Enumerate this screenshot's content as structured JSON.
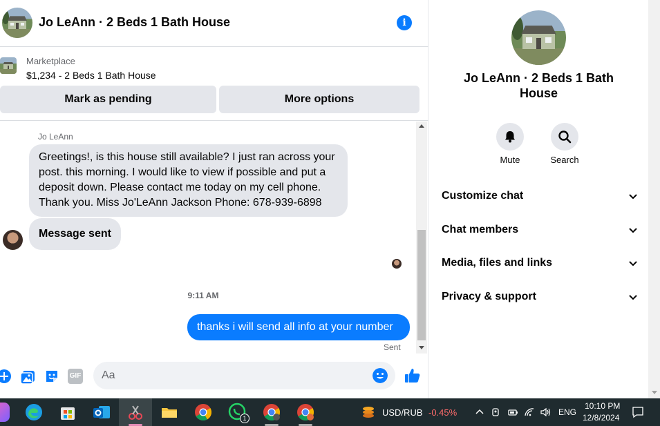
{
  "chat": {
    "title": "Jo LeAnn · 2 Beds 1 Bath House",
    "marketplace": {
      "label": "Marketplace",
      "item": "$1,234 - 2 Beds 1 Bath House",
      "pending_button": "Mark as pending",
      "more_button": "More options"
    },
    "messages": {
      "sender": "Jo LeAnn",
      "incoming_1_lines": [
        "Greetings!, is this house still available? I just ran across your",
        "post. this morning. I would like to view if possible and put a",
        "deposit down. Please contact me today on my cell phone.",
        "Thank you. Miss Jo'LeAnn Jackson Phone: 678-939-6898"
      ],
      "incoming_2": "Message sent",
      "timestamp": "9:11 AM",
      "outgoing_1": "thanks i will send all info at your number",
      "status": "Sent"
    },
    "composer": {
      "placeholder": "Aa",
      "gif_label": "GIF"
    }
  },
  "info_panel": {
    "title": "Jo LeAnn · 2 Beds 1 Bath House",
    "actions": [
      {
        "label": "Mute",
        "icon": "bell-icon"
      },
      {
        "label": "Search",
        "icon": "search-icon"
      }
    ],
    "menu": [
      {
        "label": "Customize chat"
      },
      {
        "label": "Chat members"
      },
      {
        "label": "Media, files and links"
      },
      {
        "label": "Privacy & support"
      }
    ]
  },
  "taskbar": {
    "ticker_label": "USD/RUB",
    "ticker_change": "-0.45%",
    "whatsapp_badge": "1",
    "language": "ENG",
    "time": "10:10 PM",
    "date": "12/8/2024"
  },
  "colors": {
    "accent": "#0a7cff",
    "bubble_in": "#e4e6eb",
    "taskbar": "#1f2b2f",
    "ticker_negative": "#ff6b6b"
  }
}
